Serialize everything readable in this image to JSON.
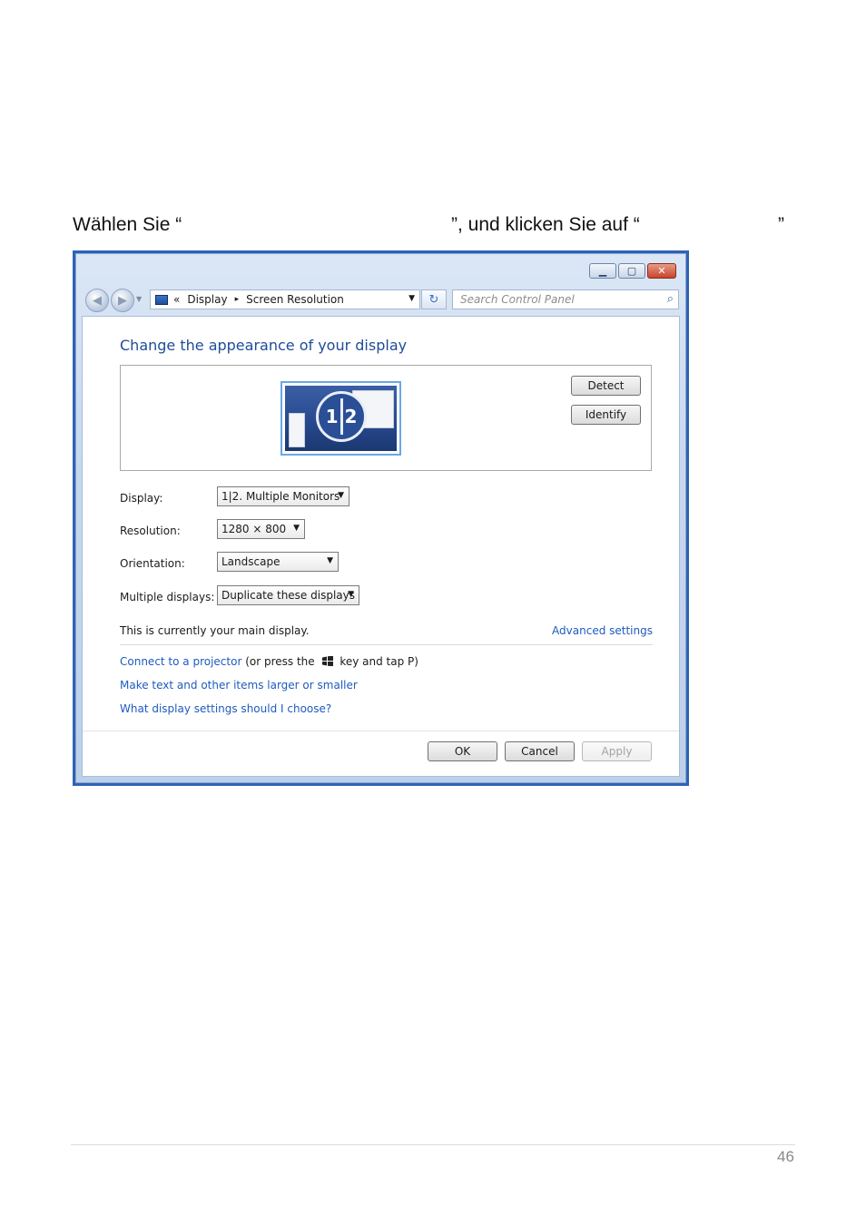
{
  "instruction": {
    "part_a": "Wählen Sie “",
    "part_b": "”, und klicken Sie auf “",
    "part_c": "”"
  },
  "window": {
    "caption_buttons": [
      "minimize-icon",
      "maximize-icon",
      "close-icon"
    ],
    "breadcrumb": {
      "overflow": "«",
      "item1": "Display",
      "separator": "▸",
      "item2": "Screen Resolution"
    },
    "search_placeholder": "Search Control Panel",
    "title": "Change the appearance of your display",
    "monitor": {
      "label_1": "1",
      "label_2": "2"
    },
    "buttons": {
      "detect": "Detect",
      "identify": "Identify",
      "ok": "OK",
      "cancel": "Cancel",
      "apply": "Apply"
    },
    "fields": {
      "display": {
        "label": "Display:",
        "value": "1|2. Multiple Monitors"
      },
      "resolution": {
        "label": "Resolution:",
        "value": "1280 × 800"
      },
      "orientation": {
        "label": "Orientation:",
        "value": "Landscape"
      },
      "multiple": {
        "label": "Multiple displays:",
        "value": "Duplicate these displays"
      }
    },
    "main_display_text": "This is currently your main display.",
    "advanced_settings": "Advanced settings",
    "links": {
      "projector": "Connect to a projector",
      "projector_hint_a": "(or press the",
      "projector_hint_b": "key and tap P)",
      "larger": "Make text and other items larger or smaller",
      "which": "What display settings should I choose?"
    }
  },
  "page_number": "46"
}
